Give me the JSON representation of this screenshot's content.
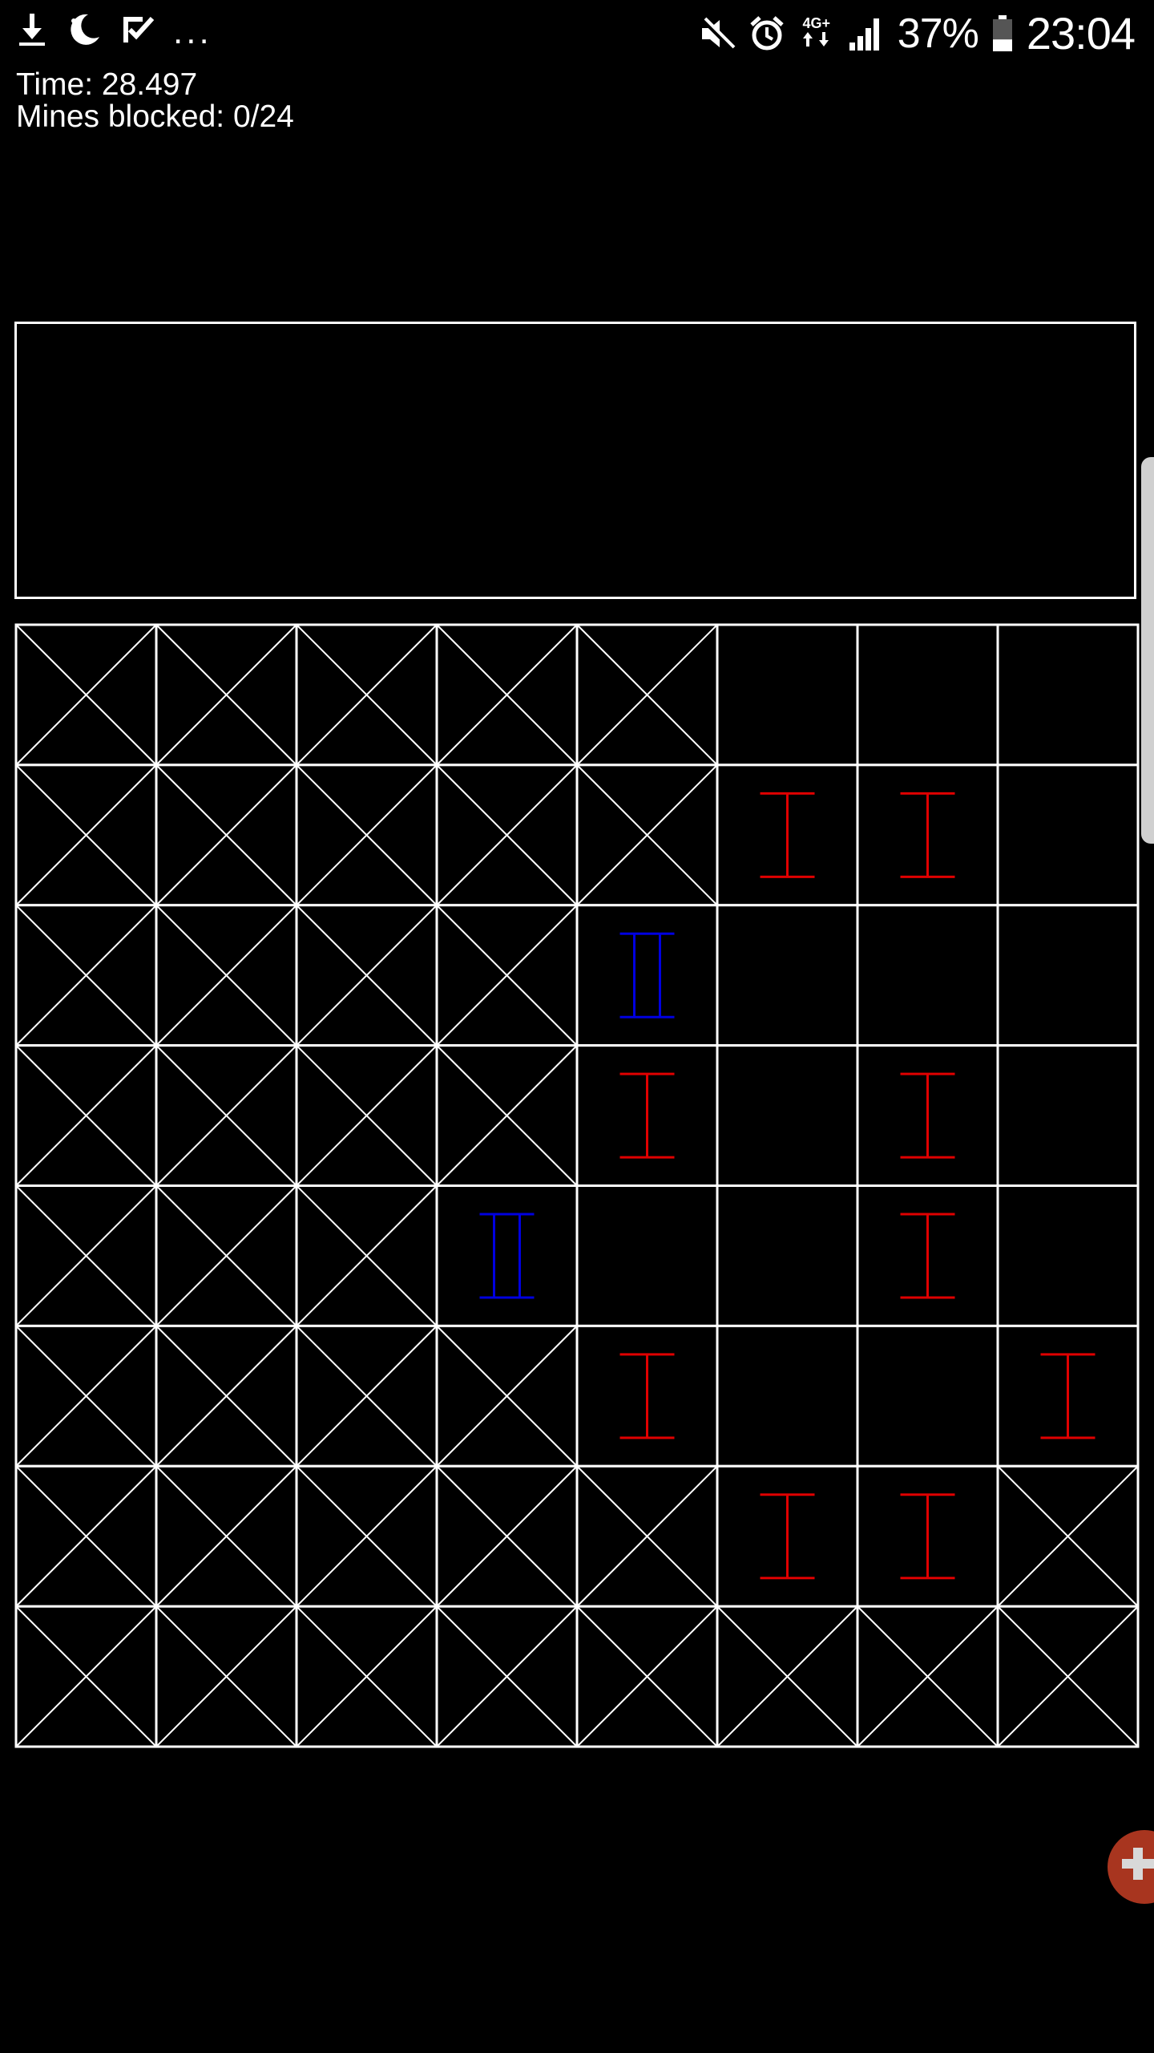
{
  "status_bar": {
    "left_icons": [
      "download-icon",
      "night-mode-icon",
      "task-check-icon"
    ],
    "more": "...",
    "right_icons": [
      "mute-icon",
      "alarm-icon",
      "network-4g-icon",
      "signal-icon",
      "battery-icon"
    ],
    "network": "4G+",
    "battery": "37%",
    "time": "23:04",
    "battery_level": 0.37
  },
  "game": {
    "time_text": "Time: 28.497",
    "mines_text": "Mines blocked: 0/24",
    "colors": {
      "grid": "#ffffff",
      "red_marker": "#e00000",
      "blue_marker": "#0000e0"
    },
    "board": {
      "rows": 8,
      "cols": 8,
      "legend": "X = crossed-out cell, . = open cell, R = red marker, B = blue double marker",
      "cells": [
        [
          "X",
          "X",
          "X",
          "X",
          "X",
          ".",
          ".",
          "."
        ],
        [
          "X",
          "X",
          "X",
          "X",
          "X",
          "R",
          "R",
          "."
        ],
        [
          "X",
          "X",
          "X",
          "X",
          "B",
          ".",
          ".",
          "."
        ],
        [
          "X",
          "X",
          "X",
          "X",
          "R",
          ".",
          "R",
          "."
        ],
        [
          "X",
          "X",
          "X",
          "B",
          ".",
          ".",
          "R",
          "."
        ],
        [
          "X",
          "X",
          "X",
          "X",
          "R",
          ".",
          ".",
          "R"
        ],
        [
          "X",
          "X",
          "X",
          "X",
          "X",
          "R",
          "R",
          "X"
        ],
        [
          "X",
          "X",
          "X",
          "X",
          "X",
          "X",
          "X",
          "X"
        ]
      ]
    }
  },
  "fab": {
    "icon": "gamepad-plus-icon",
    "color": "#a8351f"
  }
}
